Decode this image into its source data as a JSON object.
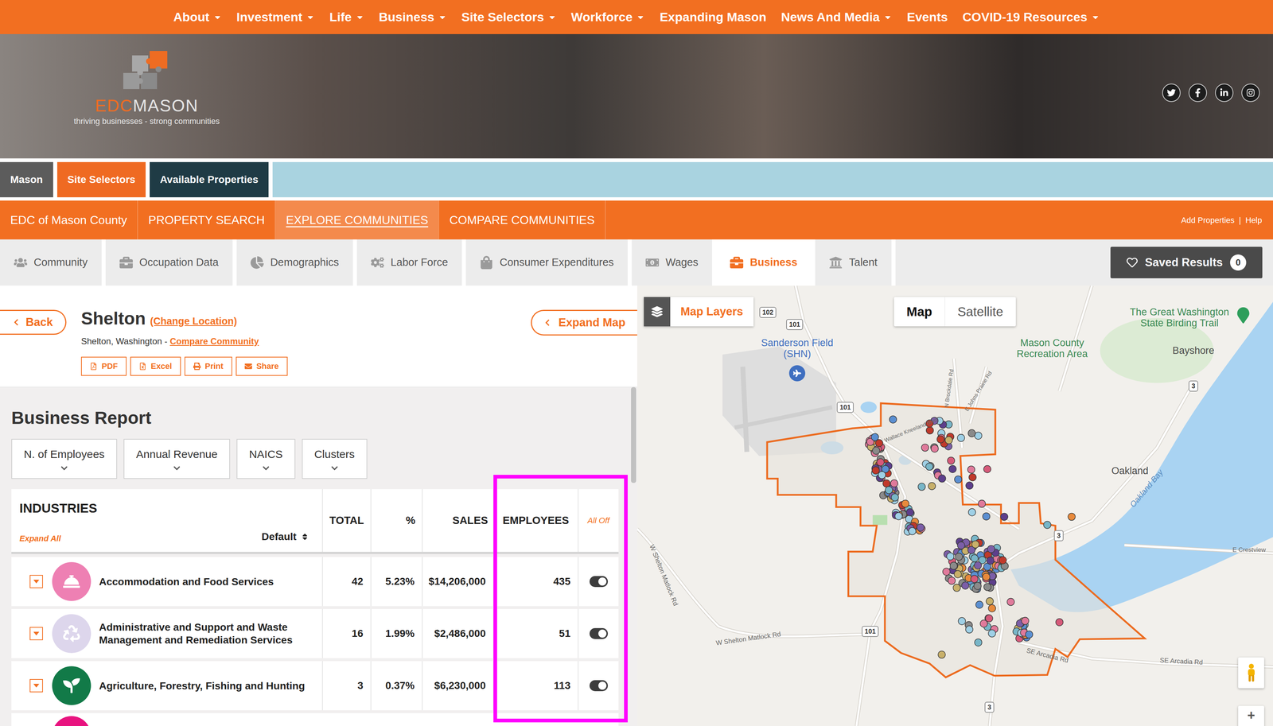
{
  "top_nav": [
    {
      "label": "About",
      "dropdown": true
    },
    {
      "label": "Investment",
      "dropdown": true
    },
    {
      "label": "Life",
      "dropdown": true
    },
    {
      "label": "Business",
      "dropdown": true
    },
    {
      "label": "Site Selectors",
      "dropdown": true
    },
    {
      "label": "Workforce",
      "dropdown": true
    },
    {
      "label": "Expanding Mason",
      "dropdown": false
    },
    {
      "label": "News And Media",
      "dropdown": true
    },
    {
      "label": "Events",
      "dropdown": false
    },
    {
      "label": "COVID-19 Resources",
      "dropdown": true
    }
  ],
  "logo": {
    "brand_accent": "EDC",
    "brand": "MASON",
    "tagline": "thriving businesses - strong communities"
  },
  "site_tabs": [
    {
      "label": "Mason",
      "color": "#5c5c5c"
    },
    {
      "label": "Site Selectors",
      "color": "#ef6a22"
    },
    {
      "label": "Available Properties",
      "color": "#1f3b45"
    }
  ],
  "main_nav": {
    "items": [
      {
        "label": "EDC of Mason County",
        "selected": false
      },
      {
        "label": "PROPERTY SEARCH",
        "selected": false
      },
      {
        "label": "EXPLORE COMMUNITIES",
        "selected": true
      },
      {
        "label": "COMPARE COMMUNITIES",
        "selected": false
      }
    ],
    "links": [
      "Add Properties",
      "|",
      "Help"
    ]
  },
  "report_tabs": [
    {
      "label": "Community",
      "selected": false
    },
    {
      "label": "Occupation Data",
      "selected": false
    },
    {
      "label": "Demographics",
      "selected": false
    },
    {
      "label": "Labor Force",
      "selected": false
    },
    {
      "label": "Consumer Expenditures",
      "selected": false
    },
    {
      "label": "Wages",
      "selected": false
    },
    {
      "label": "Business",
      "selected": true
    },
    {
      "label": "Talent",
      "selected": false
    }
  ],
  "saved_results": {
    "label": "Saved Results",
    "count": "0"
  },
  "location": {
    "back": "Back",
    "name": "Shelton",
    "change": "(Change Location)",
    "subtitle": "Shelton, Washington - ",
    "compare": "Compare Community",
    "actions": [
      "PDF",
      "Excel",
      "Print",
      "Share"
    ],
    "expand_map": "Expand Map"
  },
  "report": {
    "title": "Business Report",
    "filters": [
      "N. of Employees",
      "Annual Revenue",
      "NAICS",
      "Clusters"
    ]
  },
  "table": {
    "title": "INDUSTRIES",
    "expand_all": "Expand All",
    "sort": "Default",
    "columns": [
      "TOTAL",
      "%",
      "SALES",
      "EMPLOYEES"
    ],
    "toggle_all": "All Off",
    "rows": [
      {
        "kind": "full",
        "name": "Accommodation and Food Services",
        "total": "42",
        "percent": "5.23%",
        "sales": "$14,206,000",
        "employees": "435",
        "on": true,
        "expanded": false,
        "color": "#ee80b3"
      },
      {
        "kind": "full",
        "name": "Administrative and Support and Waste Management and Remediation Services",
        "total": "16",
        "percent": "1.99%",
        "sales": "$2,486,000",
        "employees": "51",
        "on": true,
        "expanded": false,
        "color": "#ddd6ec"
      },
      {
        "kind": "full",
        "name": "Agriculture, Forestry, Fishing and Hunting",
        "total": "3",
        "percent": "0.37%",
        "sales": "$6,230,000",
        "employees": "113",
        "on": true,
        "expanded": false,
        "color": "#127a48"
      },
      {
        "kind": "cut",
        "color": "#e8137f"
      }
    ]
  },
  "map": {
    "layers_button": "Map Layers",
    "types": [
      {
        "label": "Map",
        "selected": true
      },
      {
        "label": "Satellite",
        "selected": false
      }
    ],
    "labels": [
      {
        "text": "Sanderson Field (SHN)",
        "kind": "airport"
      },
      {
        "text": "Mason County Recreation Area",
        "kind": "park"
      },
      {
        "text": "The Great Washington State Birding Trail",
        "kind": "park"
      },
      {
        "text": "Bayshore",
        "kind": "town"
      },
      {
        "text": "Oakland",
        "kind": "town"
      },
      {
        "text": "Oakland Bay",
        "kind": "water"
      },
      {
        "text": "E Crestview",
        "kind": "road"
      },
      {
        "text": "W Shelton Matlock Rd",
        "kind": "road"
      },
      {
        "text": "W Shelton Matlock Rd",
        "kind": "road"
      },
      {
        "text": "SE Arcadia Rd",
        "kind": "road"
      },
      {
        "text": "SE Arcadia Rd",
        "kind": "road"
      },
      {
        "text": "Wallace Kneeland Blvd",
        "kind": "road"
      },
      {
        "text": "N Brockdale Rd",
        "kind": "road"
      },
      {
        "text": "E Johns Prairie Rd",
        "kind": "road"
      }
    ],
    "shields": [
      "102",
      "101",
      "101",
      "3",
      "3",
      "101",
      "3"
    ],
    "zoom_in": "+"
  }
}
